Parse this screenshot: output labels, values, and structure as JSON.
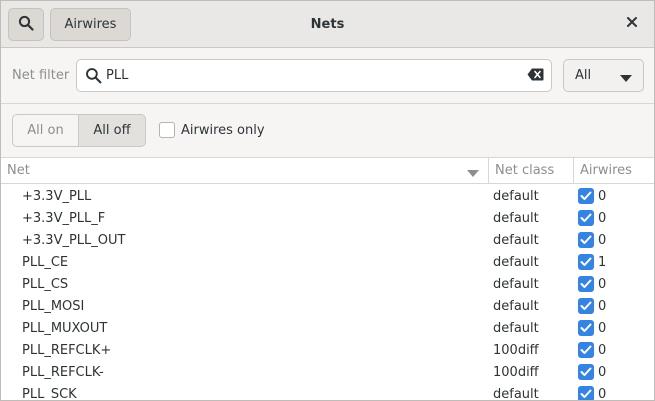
{
  "header": {
    "title": "Nets",
    "airwires_button": "Airwires",
    "icons": {
      "search": "search-icon",
      "close": "close-icon"
    }
  },
  "filter": {
    "label": "Net filter",
    "value": "PLL",
    "scope": "All",
    "icons": {
      "search": "magnifier-icon",
      "clear": "clear-text-icon",
      "dropdown": "triangle-down-icon"
    }
  },
  "toggles": {
    "all_on": "All on",
    "all_off": "All off",
    "airwires_only": "Airwires only",
    "airwires_only_checked": false
  },
  "table": {
    "columns": {
      "net": "Net",
      "net_class": "Net class",
      "airwires": "Airwires"
    },
    "rows": [
      {
        "net": "+3.3V_PLL",
        "net_class": "default",
        "airwires_checked": true,
        "count": "0"
      },
      {
        "net": "+3.3V_PLL_F",
        "net_class": "default",
        "airwires_checked": true,
        "count": "0"
      },
      {
        "net": "+3.3V_PLL_OUT",
        "net_class": "default",
        "airwires_checked": true,
        "count": "0"
      },
      {
        "net": "PLL_CE",
        "net_class": "default",
        "airwires_checked": true,
        "count": "1"
      },
      {
        "net": "PLL_CS",
        "net_class": "default",
        "airwires_checked": true,
        "count": "0"
      },
      {
        "net": "PLL_MOSI",
        "net_class": "default",
        "airwires_checked": true,
        "count": "0"
      },
      {
        "net": "PLL_MUXOUT",
        "net_class": "default",
        "airwires_checked": true,
        "count": "0"
      },
      {
        "net": "PLL_REFCLK+",
        "net_class": "100diff",
        "airwires_checked": true,
        "count": "0"
      },
      {
        "net": "PLL_REFCLK-",
        "net_class": "100diff",
        "airwires_checked": true,
        "count": "0"
      },
      {
        "net": "PLL_SCK",
        "net_class": "default",
        "airwires_checked": true,
        "count": "0"
      }
    ]
  },
  "colors": {
    "accent": "#3584e4",
    "header_bg": "#eae8e6",
    "bar_bg": "#f6f5f4"
  }
}
